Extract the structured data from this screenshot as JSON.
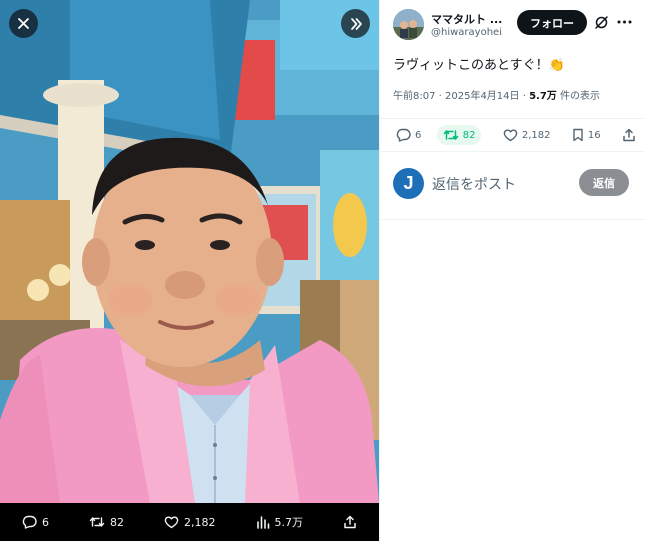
{
  "media": {
    "stats": {
      "replies": "6",
      "reposts": "82",
      "likes": "2,182",
      "views": "5.7万"
    }
  },
  "tweet": {
    "author_name": "ママタルト ...",
    "author_handle": "@hiwarayohei",
    "follow_label": "フォロー",
    "text": "ラヴィットこのあとすぐ！👏",
    "time": "午前8:07 · 2025年4月14日 · ",
    "views_count": "5.7万",
    "views_label": " 件の表示",
    "replies": "6",
    "reposts": "82",
    "likes": "2,182",
    "bookmarks": "16"
  },
  "reply": {
    "avatar_letter": "J",
    "placeholder": "返信をポスト",
    "button_label": "返信"
  },
  "colors": {
    "repost_green": "#00ba7c",
    "reply_button": "#8b8f94",
    "follow_button": "#0f1419",
    "jacket_pink": "#f29ac3"
  }
}
